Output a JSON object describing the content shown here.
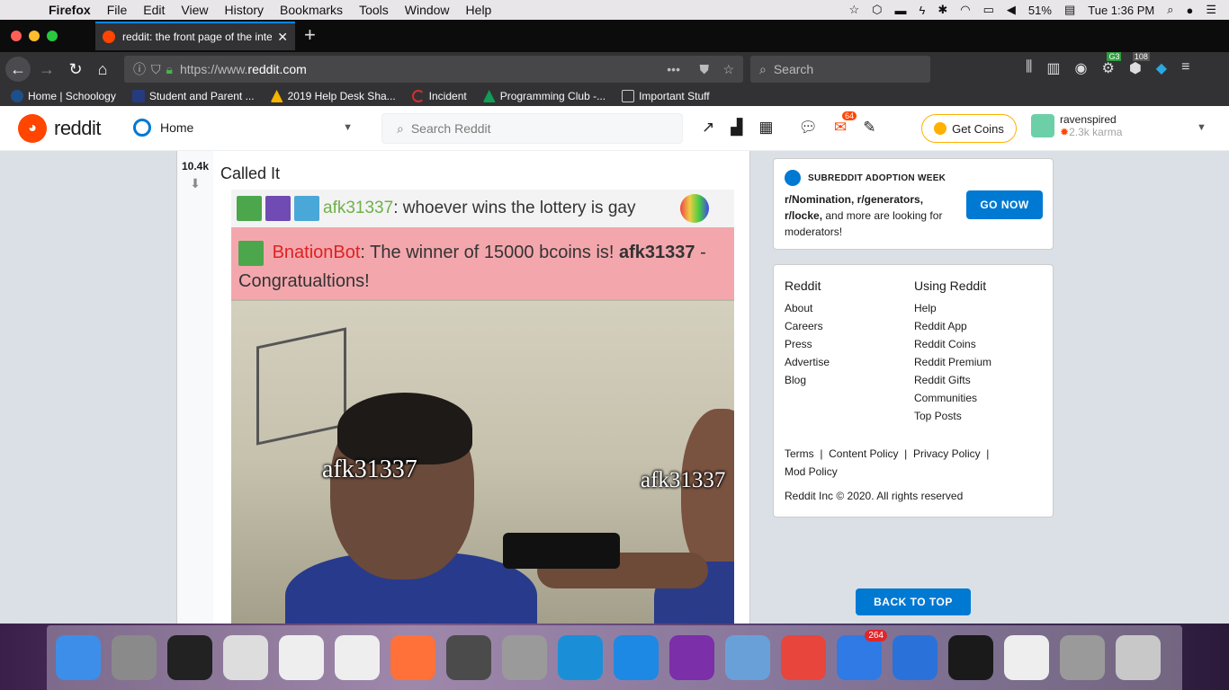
{
  "menubar": {
    "app": "Firefox",
    "items": [
      "File",
      "Edit",
      "View",
      "History",
      "Bookmarks",
      "Tools",
      "Window",
      "Help"
    ],
    "battery": "51%",
    "clock": "Tue 1:36 PM"
  },
  "browser": {
    "tab_title": "reddit: the front page of the inte",
    "url_prefix": "https://www.",
    "url_host": "reddit.com",
    "search_placeholder": "Search",
    "ext_badge_1": "G3",
    "ext_badge_2": "108"
  },
  "bookmarks": [
    {
      "label": "Home | Schoology",
      "icon": "schoology-icon",
      "color": "#1d4f8b"
    },
    {
      "label": "Student and Parent ...",
      "icon": "paypal-icon",
      "color": "#253b80"
    },
    {
      "label": "2019 Help Desk Sha...",
      "icon": "drive-icon",
      "color": "#f4b400"
    },
    {
      "label": "Incident",
      "icon": "incident-icon",
      "color": "#d42f2f"
    },
    {
      "label": "Programming Club -...",
      "icon": "drive-icon",
      "color": "#0f9d58"
    },
    {
      "label": "Important Stuff",
      "icon": "folder-icon",
      "color": "#cccccc"
    }
  ],
  "reddit": {
    "brand": "reddit",
    "feed": "Home",
    "search_placeholder": "Search Reddit",
    "mail_badge": "64",
    "get_coins": "Get Coins",
    "username": "ravenspired",
    "karma": "2.3k karma"
  },
  "post": {
    "votes": "10.4k",
    "title": "Called It",
    "chat_line_1_user": "afk31337",
    "chat_line_1_text": ": whoever wins the lottery is gay",
    "chat_line_2_user": "BnationBot",
    "chat_line_2_text": ": The winner of 15000 bcoins is! ",
    "chat_line_2_bold": "afk31337",
    "chat_line_2_end": " - Congratualtions!",
    "label_left": "afk31337",
    "label_right": "afk31337"
  },
  "sidebar": {
    "adopt_header": "SUBREDDIT ADOPTION WEEK",
    "adopt_subs": "r/Nomination, r/generators, r/locke,",
    "adopt_rest": " and more are looking for moderators!",
    "go_now": "GO NOW",
    "col1_title": "Reddit",
    "col1": [
      "About",
      "Careers",
      "Press",
      "Advertise",
      "Blog"
    ],
    "col2_title": "Using Reddit",
    "col2": [
      "Help",
      "Reddit App",
      "Reddit Coins",
      "Reddit Premium",
      "Reddit Gifts",
      "Communities",
      "Top Posts"
    ],
    "legal": [
      "Terms",
      "Content Policy",
      "Privacy Policy",
      "Mod Policy"
    ],
    "copyright": "Reddit Inc © 2020. All rights reserved",
    "back_to_top": "BACK TO TOP"
  },
  "dock": {
    "apps": [
      {
        "name": "finder",
        "color": "#3d8ee8"
      },
      {
        "name": "system-preferences",
        "color": "#8a8a8a"
      },
      {
        "name": "terminal",
        "color": "#222222"
      },
      {
        "name": "script-editor",
        "color": "#dddddd"
      },
      {
        "name": "textedit-1",
        "color": "#eeeeee"
      },
      {
        "name": "textedit-2",
        "color": "#eeeeee"
      },
      {
        "name": "firefox",
        "color": "#ff7139"
      },
      {
        "name": "sublime-text",
        "color": "#4b4b4b"
      },
      {
        "name": "unknown-app",
        "color": "#9a9a9a"
      },
      {
        "name": "vnc-viewer",
        "color": "#1a8fd8"
      },
      {
        "name": "vscode",
        "color": "#1e88e5"
      },
      {
        "name": "github-desktop",
        "color": "#7b2fa8"
      },
      {
        "name": "preview",
        "color": "#6aa0d8"
      },
      {
        "name": "chrome",
        "color": "#e8453c"
      },
      {
        "name": "airmail",
        "color": "#2f7ae5",
        "badge": "264"
      },
      {
        "name": "bluetooth-file-exchange",
        "color": "#2a72d9"
      },
      {
        "name": "activity-monitor",
        "color": "#1a1a1a"
      },
      {
        "name": "screenshot",
        "color": "#eeeeee"
      },
      {
        "name": "unknown-app-2",
        "color": "#9a9a9a"
      },
      {
        "name": "trash",
        "color": "#c8c8c8"
      }
    ]
  }
}
